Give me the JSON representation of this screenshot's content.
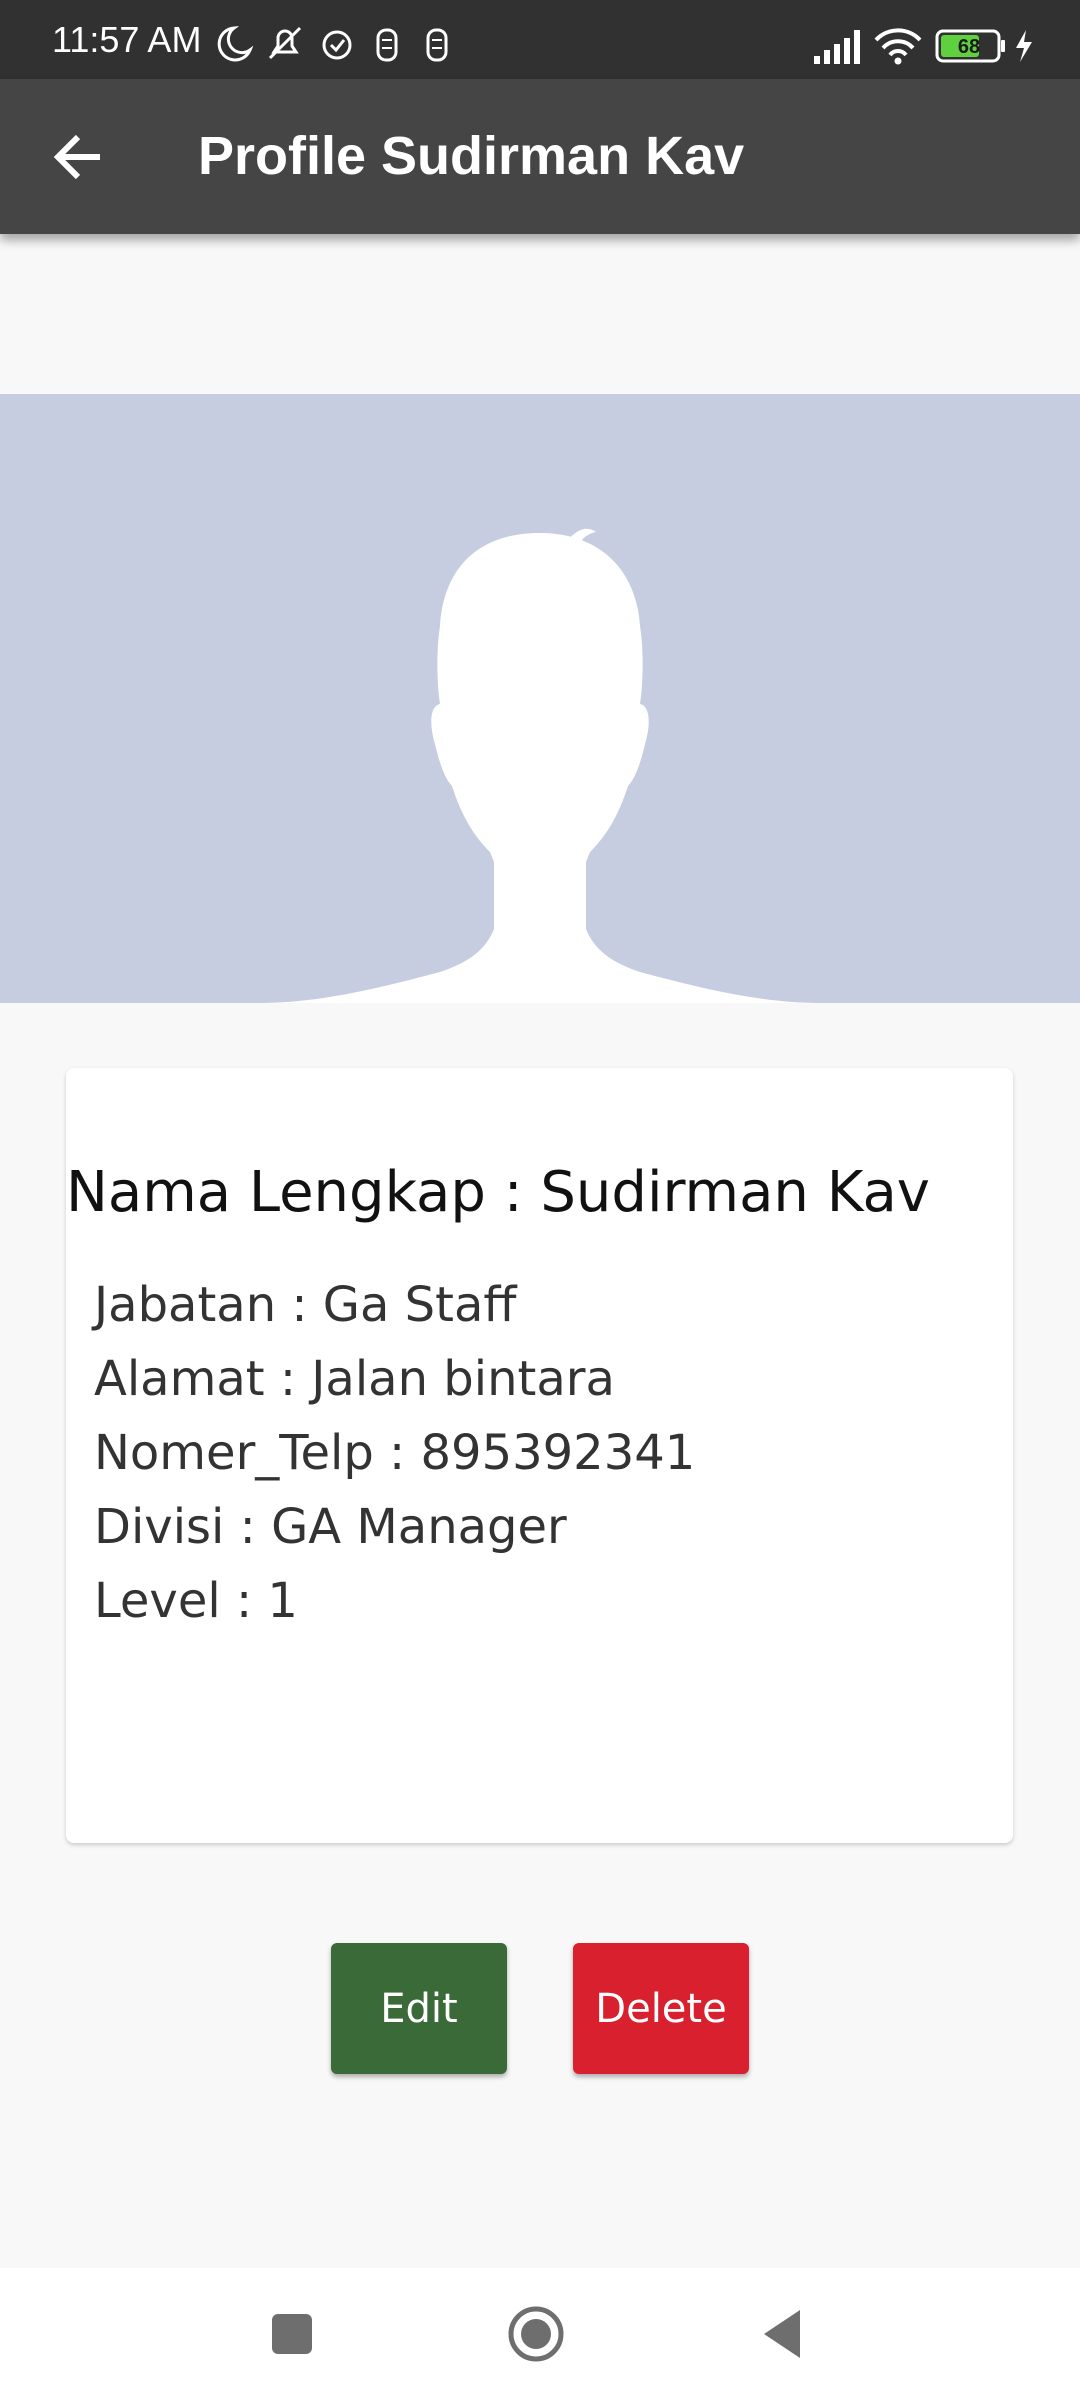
{
  "status_bar": {
    "time": "11:57 AM",
    "battery_level": "68",
    "icons_left": [
      "moon-icon",
      "bell-off-icon",
      "alarm-icon",
      "notification-icon",
      "notification-icon"
    ],
    "icons_right": [
      "signal-icon",
      "wifi-icon",
      "battery-icon",
      "charging-icon"
    ]
  },
  "app_bar": {
    "title": "Profile Sudirman Kav",
    "back_icon": "arrow-left-icon",
    "color": "#454545"
  },
  "avatar": {
    "icon": "person-silhouette-icon",
    "background": "#c7cde0"
  },
  "profile": {
    "heading": "Nama Lengkap : Sudirman Kav",
    "details": [
      "Jabatan : Ga Staff",
      "Alamat : Jalan bintara",
      "Nomer_Telp : 895392341",
      "Divisi : GA Manager",
      "Level :  1"
    ]
  },
  "actions": {
    "edit_label": "Edit",
    "delete_label": "Delete",
    "edit_color": "#396a37",
    "delete_color": "#d8202f"
  },
  "nav_bar": {
    "icons": [
      "recents-square-icon",
      "home-circle-icon",
      "back-triangle-icon"
    ]
  }
}
